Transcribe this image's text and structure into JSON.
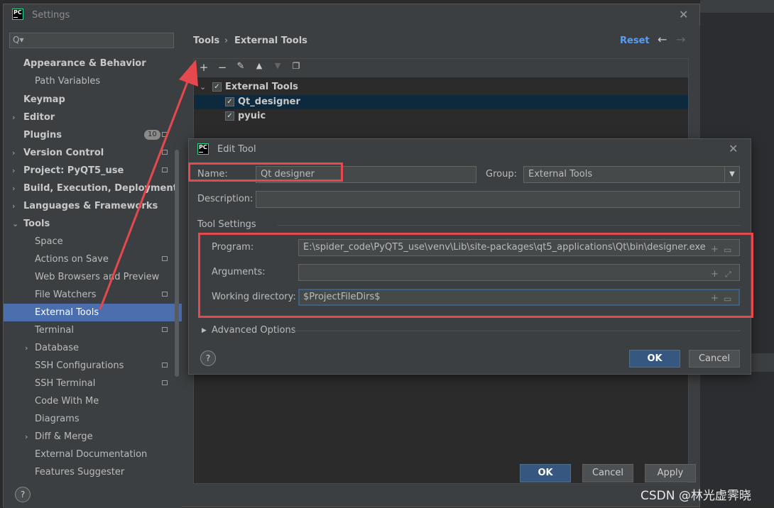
{
  "settings": {
    "title": "Settings",
    "search": {
      "placeholder": "Q▾"
    },
    "sidebar": {
      "items": [
        {
          "label": "Appearance & Behavior"
        },
        {
          "label": "Path Variables"
        },
        {
          "label": "Keymap"
        },
        {
          "label": "Editor"
        },
        {
          "label": "Plugins",
          "badge": "10"
        },
        {
          "label": "Version Control"
        },
        {
          "label": "Project: PyQT5_use"
        },
        {
          "label": "Build, Execution, Deployment"
        },
        {
          "label": "Languages & Frameworks"
        },
        {
          "label": "Tools"
        },
        {
          "label": "Space"
        },
        {
          "label": "Actions on Save"
        },
        {
          "label": "Web Browsers and Preview"
        },
        {
          "label": "File Watchers"
        },
        {
          "label": "External Tools"
        },
        {
          "label": "Terminal"
        },
        {
          "label": "Database"
        },
        {
          "label": "SSH Configurations"
        },
        {
          "label": "SSH Terminal"
        },
        {
          "label": "Code With Me"
        },
        {
          "label": "Diagrams"
        },
        {
          "label": "Diff & Merge"
        },
        {
          "label": "External Documentation"
        },
        {
          "label": "Features Suggester"
        }
      ]
    },
    "breadcrumb": {
      "parent": "Tools",
      "separator": "›",
      "current": "External Tools"
    },
    "reset_label": "Reset",
    "toolbar_icons": [
      "add-icon",
      "remove-icon",
      "edit-icon",
      "move-up-icon",
      "move-down-icon",
      "copy-icon"
    ],
    "tree": {
      "group": {
        "label": "External Tools",
        "checked": true
      },
      "tools": [
        {
          "label": "Qt_designer",
          "checked": true,
          "selected": true
        },
        {
          "label": "pyuic",
          "checked": true
        }
      ]
    },
    "buttons": {
      "ok": "OK",
      "cancel": "Cancel",
      "apply": "Apply"
    },
    "help": "?"
  },
  "edit_tool": {
    "title": "Edit Tool",
    "name_label": "Name:",
    "name_value": "Qt designer",
    "group_label": "Group:",
    "group_value": "External Tools",
    "description_label": "Description:",
    "description_value": "",
    "tool_settings_label": "Tool Settings",
    "program_label": "Program:",
    "program_value": "E:\\spider_code\\PyQT5_use\\venv\\Lib\\site-packages\\qt5_applications\\Qt\\bin\\designer.exe",
    "arguments_label": "Arguments:",
    "arguments_value": "",
    "workdir_label": "Working directory:",
    "workdir_value": "$ProjectFileDirs$",
    "advanced_label": "Advanced Options",
    "ok": "OK",
    "cancel": "Cancel",
    "help": "?"
  },
  "annotation": {
    "color": "#e5484d"
  },
  "watermark": "CSDN @林光虚霁晓"
}
